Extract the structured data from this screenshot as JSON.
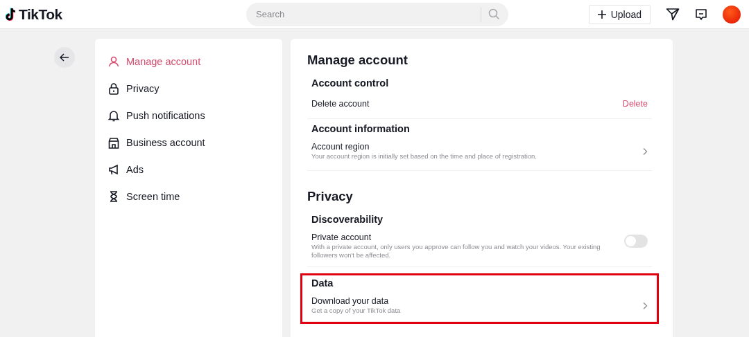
{
  "header": {
    "logo": "TikTok",
    "search": {
      "placeholder": "Search"
    },
    "upload": "Upload"
  },
  "sidebar": {
    "items": [
      {
        "label": "Manage account",
        "selected": true
      },
      {
        "label": "Privacy",
        "selected": false
      },
      {
        "label": "Push notifications",
        "selected": false
      },
      {
        "label": "Business account",
        "selected": false
      },
      {
        "label": "Ads",
        "selected": false
      },
      {
        "label": "Screen time",
        "selected": false
      }
    ]
  },
  "sections": [
    {
      "title": "Manage account",
      "groups": [
        {
          "heading": "Account control",
          "highlighted": false,
          "rows": [
            {
              "kind": "action",
              "label": "Delete account",
              "action": "Delete"
            }
          ]
        },
        {
          "heading": "Account information",
          "highlighted": false,
          "rows": [
            {
              "kind": "link",
              "label": "Account region",
              "description": "Your account region is initially set based on the time and place of registration."
            }
          ]
        }
      ]
    },
    {
      "title": "Privacy",
      "groups": [
        {
          "heading": "Discoverability",
          "highlighted": false,
          "rows": [
            {
              "kind": "toggle",
              "label": "Private account",
              "description": "With a private account, only users you approve can follow you and watch your videos. Your existing followers won't be affected.",
              "on": false
            }
          ]
        },
        {
          "heading": "Data",
          "highlighted": true,
          "rows": [
            {
              "kind": "link",
              "label": "Download your data",
              "description": "Get a copy of your TikTok data"
            }
          ]
        }
      ]
    }
  ]
}
